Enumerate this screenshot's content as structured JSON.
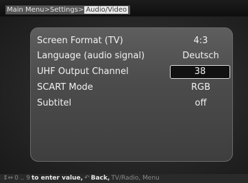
{
  "breadcrumb": {
    "items": [
      "Main Menu",
      "Settings"
    ],
    "current": "Audio/Video",
    "separator": ">"
  },
  "settings": [
    {
      "label": "Screen Format (TV)",
      "value": "4:3",
      "selected": false
    },
    {
      "label": "Language (audio signal)",
      "value": "Deutsch",
      "selected": false
    },
    {
      "label": "UHF Output Channel",
      "value": "38",
      "selected": true
    },
    {
      "label": "SCART Mode",
      "value": "RGB",
      "selected": false
    },
    {
      "label": "Subtitel",
      "value": "off",
      "selected": false
    }
  ],
  "footer": {
    "keys_prefix": "0 .. 9",
    "enter_text": "to enter value,",
    "back_text": "Back,",
    "menu_text": "TV/Radio, Menu"
  },
  "icons": {
    "navigate": "up-down-arrows-icon",
    "back": "back-arrow-icon"
  }
}
